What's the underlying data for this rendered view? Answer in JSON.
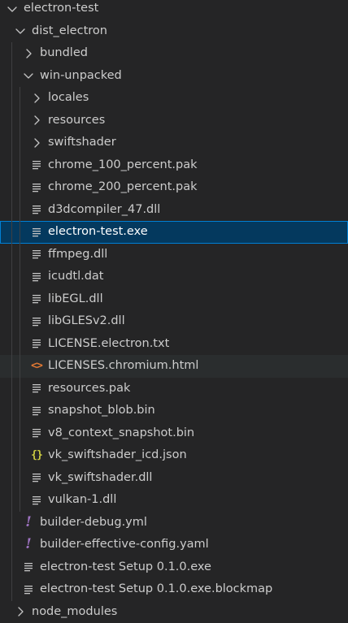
{
  "colors": {
    "background": "#252526",
    "selected_bg": "#04395e",
    "selected_outline": "#007fd4",
    "hover_bg": "#2a2d2e",
    "text": "#cccccc",
    "html_icon": "#e37933",
    "json_icon": "#cbcb41",
    "yaml_icon": "#a074c4"
  },
  "explorer": {
    "items": [
      {
        "label": "electron-test",
        "type": "folder",
        "expanded": true,
        "depth": 0,
        "icon": "chevron-down-icon"
      },
      {
        "label": "dist_electron",
        "type": "folder",
        "expanded": true,
        "depth": 1,
        "icon": "chevron-down-icon"
      },
      {
        "label": "bundled",
        "type": "folder",
        "expanded": false,
        "depth": 2,
        "icon": "chevron-right-icon"
      },
      {
        "label": "win-unpacked",
        "type": "folder",
        "expanded": true,
        "depth": 2,
        "icon": "chevron-down-icon"
      },
      {
        "label": "locales",
        "type": "folder",
        "expanded": false,
        "depth": 3,
        "icon": "chevron-right-icon"
      },
      {
        "label": "resources",
        "type": "folder",
        "expanded": false,
        "depth": 3,
        "icon": "chevron-right-icon"
      },
      {
        "label": "swiftshader",
        "type": "folder",
        "expanded": false,
        "depth": 3,
        "icon": "chevron-right-icon"
      },
      {
        "label": "chrome_100_percent.pak",
        "type": "file",
        "depth": 3,
        "icon": "file-lines-icon"
      },
      {
        "label": "chrome_200_percent.pak",
        "type": "file",
        "depth": 3,
        "icon": "file-lines-icon"
      },
      {
        "label": "d3dcompiler_47.dll",
        "type": "file",
        "depth": 3,
        "icon": "file-lines-icon"
      },
      {
        "label": "electron-test.exe",
        "type": "file",
        "depth": 3,
        "icon": "file-lines-icon",
        "selected": true
      },
      {
        "label": "ffmpeg.dll",
        "type": "file",
        "depth": 3,
        "icon": "file-lines-icon"
      },
      {
        "label": "icudtl.dat",
        "type": "file",
        "depth": 3,
        "icon": "file-lines-icon"
      },
      {
        "label": "libEGL.dll",
        "type": "file",
        "depth": 3,
        "icon": "file-lines-icon"
      },
      {
        "label": "libGLESv2.dll",
        "type": "file",
        "depth": 3,
        "icon": "file-lines-icon"
      },
      {
        "label": "LICENSE.electron.txt",
        "type": "file",
        "depth": 3,
        "icon": "file-lines-icon"
      },
      {
        "label": "LICENSES.chromium.html",
        "type": "file",
        "depth": 3,
        "icon": "html-file-icon",
        "hovered": true
      },
      {
        "label": "resources.pak",
        "type": "file",
        "depth": 3,
        "icon": "file-lines-icon"
      },
      {
        "label": "snapshot_blob.bin",
        "type": "file",
        "depth": 3,
        "icon": "file-lines-icon"
      },
      {
        "label": "v8_context_snapshot.bin",
        "type": "file",
        "depth": 3,
        "icon": "file-lines-icon"
      },
      {
        "label": "vk_swiftshader_icd.json",
        "type": "file",
        "depth": 3,
        "icon": "json-file-icon"
      },
      {
        "label": "vk_swiftshader.dll",
        "type": "file",
        "depth": 3,
        "icon": "file-lines-icon"
      },
      {
        "label": "vulkan-1.dll",
        "type": "file",
        "depth": 3,
        "icon": "file-lines-icon"
      },
      {
        "label": "builder-debug.yml",
        "type": "file",
        "depth": 2,
        "icon": "yaml-file-icon"
      },
      {
        "label": "builder-effective-config.yaml",
        "type": "file",
        "depth": 2,
        "icon": "yaml-file-icon"
      },
      {
        "label": "electron-test Setup 0.1.0.exe",
        "type": "file",
        "depth": 2,
        "icon": "file-lines-icon"
      },
      {
        "label": "electron-test Setup 0.1.0.exe.blockmap",
        "type": "file",
        "depth": 2,
        "icon": "file-lines-icon"
      },
      {
        "label": "node_modules",
        "type": "folder",
        "expanded": false,
        "depth": 1,
        "icon": "chevron-right-icon"
      }
    ]
  }
}
